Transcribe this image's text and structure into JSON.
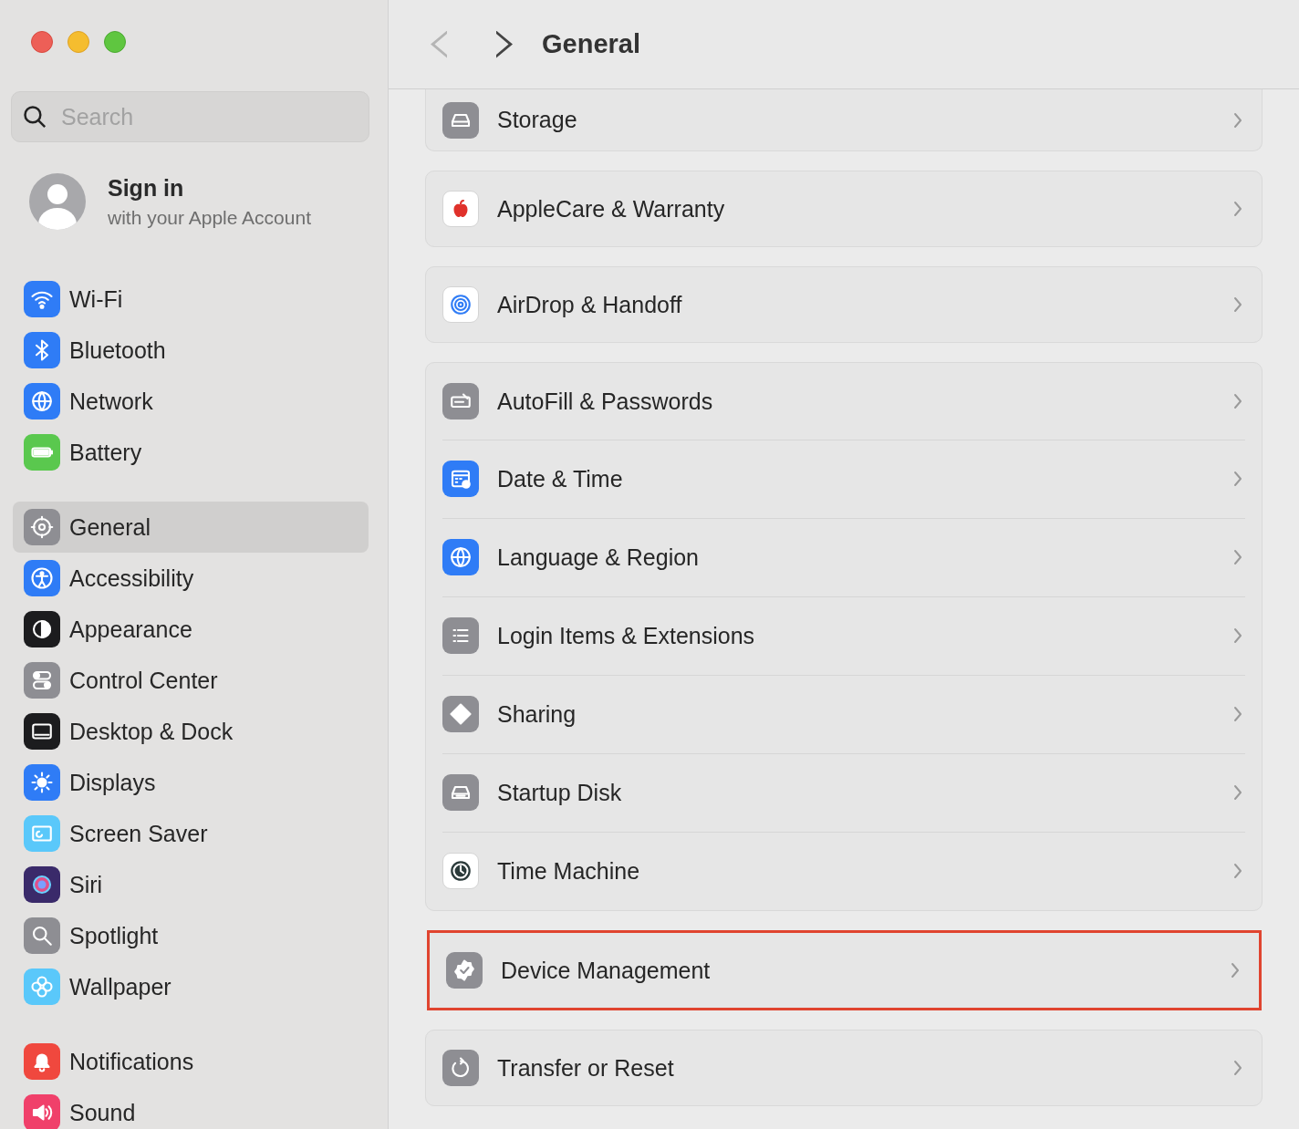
{
  "sidebar": {
    "search": {
      "placeholder": "Search"
    },
    "account": {
      "title": "Sign in",
      "subtitle": "with your Apple Account"
    },
    "groups": [
      {
        "items": [
          {
            "label": "Wi-Fi",
            "color": "#2f7cf6",
            "selected": false
          },
          {
            "label": "Bluetooth",
            "color": "#2f7cf6",
            "selected": false
          },
          {
            "label": "Network",
            "color": "#2f7cf6",
            "selected": false
          },
          {
            "label": "Battery",
            "color": "#5ac84e",
            "selected": false
          }
        ]
      },
      {
        "items": [
          {
            "label": "General",
            "color": "#8e8e93",
            "selected": true
          },
          {
            "label": "Accessibility",
            "color": "#2f7cf6",
            "selected": false
          },
          {
            "label": "Appearance",
            "color": "#1c1c1e",
            "selected": false
          },
          {
            "label": "Control Center",
            "color": "#8e8e93",
            "selected": false
          },
          {
            "label": "Desktop & Dock",
            "color": "#1c1c1e",
            "selected": false
          },
          {
            "label": "Displays",
            "color": "#2f7cf6",
            "selected": false
          },
          {
            "label": "Screen Saver",
            "color": "#5ac8fa",
            "selected": false
          },
          {
            "label": "Siri",
            "color": "#3a2a6a",
            "selected": false
          },
          {
            "label": "Spotlight",
            "color": "#8e8e93",
            "selected": false
          },
          {
            "label": "Wallpaper",
            "color": "#5ac8fa",
            "selected": false
          }
        ]
      },
      {
        "items": [
          {
            "label": "Notifications",
            "color": "#f0483e",
            "selected": false
          },
          {
            "label": "Sound",
            "color": "#f0406a",
            "selected": false
          }
        ]
      }
    ]
  },
  "toolbar": {
    "back": {
      "disabled": true
    },
    "forward": {
      "disabled": false
    },
    "title": "General"
  },
  "content": {
    "groups": [
      {
        "highlighted": false,
        "items": [
          {
            "label": "Storage",
            "color": "#8e8e93"
          }
        ]
      },
      {
        "highlighted": false,
        "items": [
          {
            "label": "AppleCare & Warranty",
            "color": "#ffffff"
          }
        ]
      },
      {
        "highlighted": false,
        "items": [
          {
            "label": "AirDrop & Handoff",
            "color": "#ffffff"
          }
        ]
      },
      {
        "highlighted": false,
        "items": [
          {
            "label": "AutoFill & Passwords",
            "color": "#8e8e93"
          },
          {
            "label": "Date & Time",
            "color": "#2f7cf6"
          },
          {
            "label": "Language & Region",
            "color": "#2f7cf6"
          },
          {
            "label": "Login Items & Extensions",
            "color": "#8e8e93"
          },
          {
            "label": "Sharing",
            "color": "#8e8e93"
          },
          {
            "label": "Startup Disk",
            "color": "#8e8e93"
          },
          {
            "label": "Time Machine",
            "color": "#ffffff"
          }
        ]
      },
      {
        "highlighted": true,
        "items": [
          {
            "label": "Device Management",
            "color": "#8e8e93"
          }
        ]
      },
      {
        "highlighted": false,
        "items": [
          {
            "label": "Transfer or Reset",
            "color": "#8e8e93"
          }
        ]
      }
    ]
  }
}
